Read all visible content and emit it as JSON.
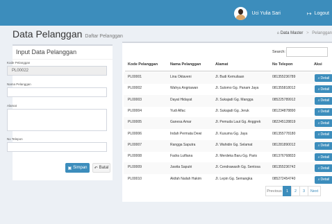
{
  "topbar": {
    "user_name": "Uci Yulia Sari",
    "logout_label": "Logout"
  },
  "header": {
    "title": "Data Pelanggan",
    "subtitle": "Daftar Pelanggan",
    "breadcrumb": [
      "Data Master",
      "Pelanggan"
    ]
  },
  "form": {
    "title": "Input Data Pelanggan",
    "kode_label": "Kode Pelanggan",
    "kode_value": "PL00022",
    "nama_label": "Nama Pelanggan",
    "nama_value": "",
    "alamat_label": "Alamat",
    "alamat_value": "",
    "telepon_label": "No Telepon",
    "telepon_value": "",
    "simpan_label": "Simpan",
    "batal_label": "Batal"
  },
  "table": {
    "search_label": "Search:",
    "search_value": "",
    "columns": [
      "Kode Pelanggan",
      "Nama Pelanggan",
      "Alamat",
      "No Telepon",
      "Aksi"
    ],
    "detail_label": "Detail",
    "rows": [
      [
        "PL00001",
        "Lina Oktaveni",
        "Jl. Budi Kemuliaan",
        "081355236789"
      ],
      [
        "PL00002",
        "Wahyu Angriawan",
        "Jl. Sutomo Gg. Panam Jaya",
        "081355818012"
      ],
      [
        "PL00003",
        "Dayat Hidayat",
        "Jl. Sukajadi Gg. Mangga",
        "085225789912"
      ],
      [
        "PL00004",
        "Yudi Alfac",
        "Jl. Sukajadi Gg. Jeruk",
        "081234878890"
      ],
      [
        "PL00005",
        "Ganesa Amar",
        "Jl. Pemuda Laut Gg. Anggrek",
        "082245128819"
      ],
      [
        "PL00006",
        "Indah Permata Dewi",
        "Jl. Kusuma Gg. Jaya",
        "081355778180"
      ],
      [
        "PL00007",
        "Rangga Saputra",
        "Jl. Wahidin Gg. Selamat",
        "081281890012"
      ],
      [
        "PL00008",
        "Fadra Lutfiana",
        "Jl. Merdeka Baru Gg. Paris",
        "081376768833"
      ],
      [
        "PL00009",
        "Juwita Saputri",
        "Jl. Cendrawasih Gg. Sentosa",
        "081355236742"
      ],
      [
        "PL00010",
        "Akifah Nailah Hakim",
        "Jl. Lepin Gg. Semangka",
        "085272454740"
      ]
    ],
    "pagination": {
      "previous": "Previous",
      "pages": [
        "1",
        "2",
        "3"
      ],
      "active_page": "1",
      "next": "Next"
    }
  },
  "colors": {
    "accent": "#3c8dbc",
    "background": "#ecf0f5"
  }
}
